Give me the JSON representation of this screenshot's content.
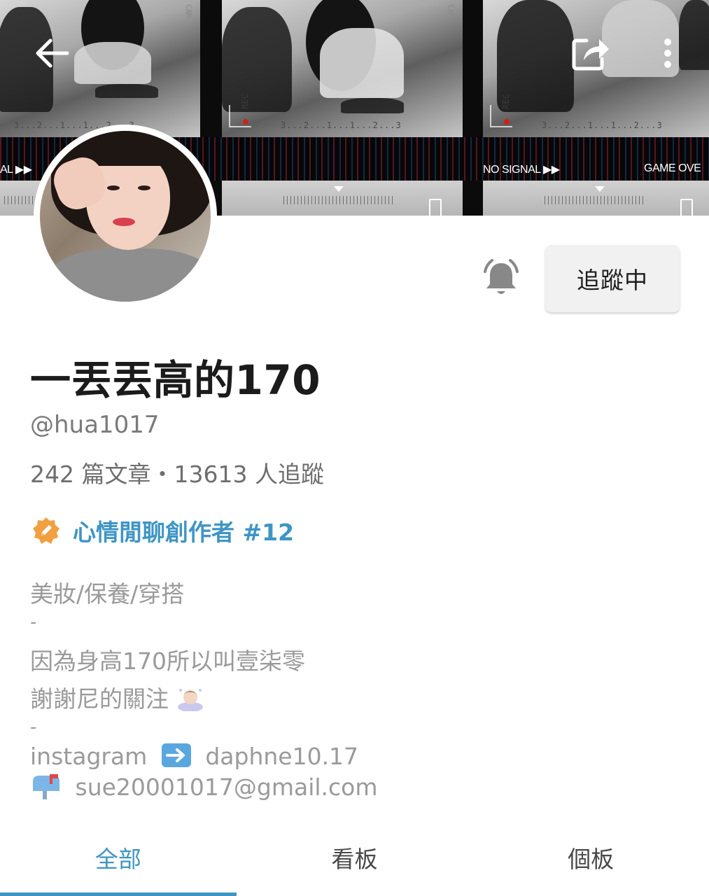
{
  "cover": {
    "signal_left": "AL  ▶▶",
    "signal_mid": "NO SIGNAL  ▶▶",
    "signal_right": "GAME OVE",
    "rec": "REC",
    "cam": "CAM",
    "countdown": "3...2...1...1...2...3"
  },
  "header": {
    "back_icon": "arrow-left-icon",
    "share_icon": "share-icon",
    "more_icon": "more-vertical-icon"
  },
  "profile": {
    "name": "一丟丟高的170",
    "handle": "@hua1017",
    "stats": "242 篇文章・13613 人追蹤",
    "badge_label": "心情閒聊創作者 #12",
    "badge_icon": "pencil-badge-icon",
    "follow_label": "追蹤中",
    "bell_icon": "bell-icon",
    "accent_color": "#3e95c4"
  },
  "bio": {
    "line1": "美妝/保養/穿搭",
    "sep1": "-",
    "line2": "因為身高170所以叫壹柒零",
    "line3": "謝謝尼的關注",
    "sep2": "-",
    "ig_label": "instagram",
    "ig_handle": "daphne10.17",
    "email": "sue20001017@gmail.com"
  },
  "tabs": {
    "all": "全部",
    "boards": "看板",
    "personal": "個板",
    "active": "all"
  }
}
